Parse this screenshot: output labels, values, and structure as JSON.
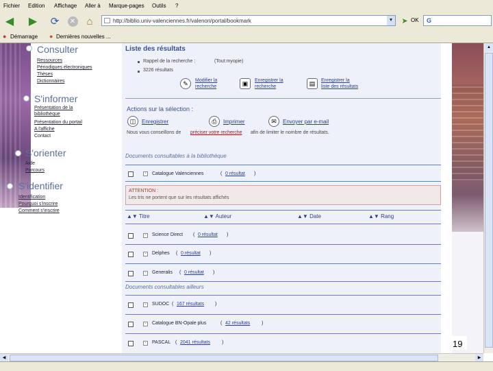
{
  "menubar": {
    "items": [
      "Fichier",
      "Edition",
      "Affichage",
      "Aller à",
      "Marque-pages",
      "Outils",
      "?"
    ]
  },
  "toolbar": {
    "url": "http://biblio.univ-valenciennes.fr/valenon/portal/bookmark",
    "ok_label": "OK",
    "search_value": "G"
  },
  "bookmarks": {
    "items": [
      "Démarrage",
      "Dernières nouvelles ..."
    ]
  },
  "nav": {
    "consulter": {
      "title": "Consulter",
      "links": [
        "Ressources",
        "Périodiques électroniques",
        "Thèses",
        "Dictionnaires"
      ]
    },
    "informer": {
      "title": "S'informer",
      "links": [
        "Présentation de la",
        "bibliothèque",
        "Présentation du portail",
        "A l'affiche",
        "Contact"
      ]
    },
    "orienter": {
      "title": "S'orienter",
      "links": [
        "Aide",
        "Parcours"
      ]
    },
    "identifier": {
      "title": "S'identifier",
      "links": [
        "Identification",
        "Pourquoi s'inscrire",
        "Comment s'inscrire"
      ]
    }
  },
  "results": {
    "title": "Liste des résultats",
    "recall_label": "Rappel de la recherche :",
    "recall_value": "(Tout:myopie)",
    "count": "3226 résultats",
    "actions": {
      "modify": [
        "Modifier la",
        "recherche"
      ],
      "save": [
        "Enregistrer la",
        "recherche"
      ],
      "save_list": [
        "Enregistrer la",
        "liste des résultats"
      ]
    }
  },
  "selection": {
    "title": "Actions sur la sélection :",
    "save": "Enregistrer",
    "print": "Imprimer",
    "email": "Envoyer par e-mail",
    "advice_prefix": "Nous vous conseillons de",
    "advice_link": "préciser votre recherche",
    "advice_suffix": "afin de limiter le nombre de résultats."
  },
  "local_docs": {
    "title": "Documents consultables à la bibliothèque",
    "items": [
      {
        "name": "Catalogue Valenciennes",
        "results": "0 résultat"
      }
    ]
  },
  "attention": {
    "title": "ATTENTION :",
    "text": "Les tris ne portent que sur les résultats affichés"
  },
  "sort": {
    "titre": "Titre",
    "auteur": "Auteur",
    "date": "Date",
    "rang": "Rang"
  },
  "databases": [
    {
      "name": "Science Direct",
      "results": "0 résultat"
    },
    {
      "name": "Delphes",
      "results": "0 résultat"
    },
    {
      "name": "Generalis",
      "results": "0 résultat"
    }
  ],
  "elsewhere": {
    "title": "Documents consultables ailleurs",
    "items": [
      {
        "name": "SUDOC",
        "results": "167 résultats"
      },
      {
        "name": "Catalogue BN-Opale plus",
        "results": "42 résultats"
      },
      {
        "name": "PASCAL",
        "results": "2041 résultats"
      }
    ]
  },
  "slide_number": "19"
}
